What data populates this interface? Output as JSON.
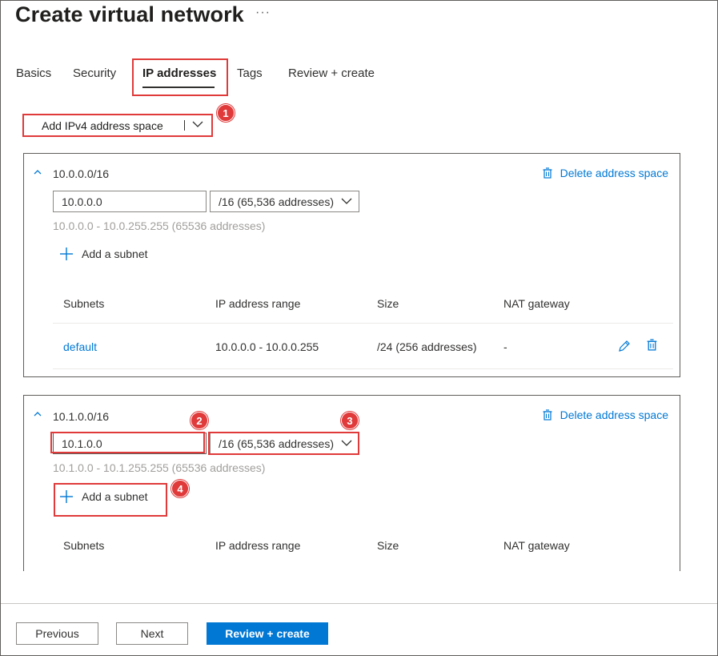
{
  "page": {
    "title": "Create virtual network",
    "more_label": "···"
  },
  "tabs": [
    {
      "label": "Basics"
    },
    {
      "label": "Security"
    },
    {
      "label": "IP addresses",
      "selected": true
    },
    {
      "label": "Tags"
    },
    {
      "label": "Review + create"
    }
  ],
  "add_space": {
    "label": "Add IPv4 address space"
  },
  "address_spaces": [
    {
      "title": "10.0.0.0/16",
      "delete_label": "Delete address space",
      "address_value": "10.0.0.0",
      "size_value": "/16 (65,536 addresses)",
      "range_hint": "10.0.0.0 - 10.0.255.255 (65536 addresses)",
      "add_subnet_label": "Add a subnet",
      "columns": [
        "Subnets",
        "IP address range",
        "Size",
        "NAT gateway"
      ],
      "rows": [
        {
          "name": "default",
          "range": "10.0.0.0 - 10.0.0.255",
          "size": "/24 (256 addresses)",
          "nat": "-"
        }
      ]
    },
    {
      "title": "10.1.0.0/16",
      "delete_label": "Delete address space",
      "address_value": "10.1.0.0",
      "size_value": "/16 (65,536 addresses)",
      "range_hint": "10.1.0.0 - 10.1.255.255 (65536 addresses)",
      "add_subnet_label": "Add a subnet",
      "columns": [
        "Subnets",
        "IP address range",
        "Size",
        "NAT gateway"
      ]
    }
  ],
  "callouts": [
    "1",
    "2",
    "3",
    "4"
  ],
  "footer": {
    "previous": "Previous",
    "next": "Next",
    "review_create": "Review + create"
  },
  "colors": {
    "accent": "#0078d4",
    "callout": "#e03a3a",
    "hint_text": "#a19f9d"
  },
  "icons": [
    "more-icon",
    "chevron-down-icon",
    "chevron-up-icon",
    "trash-icon",
    "plus-icon",
    "pencil-icon"
  ]
}
